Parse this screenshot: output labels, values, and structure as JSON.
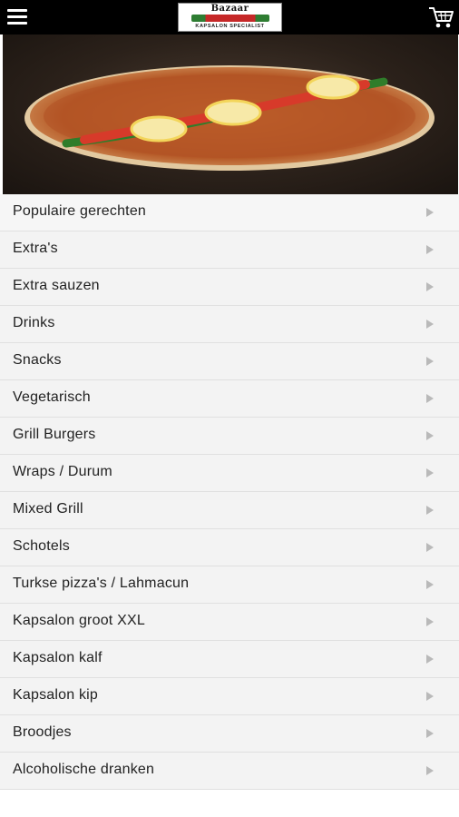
{
  "header": {
    "menu_icon": "hamburger-menu-icon",
    "logo": {
      "top_text": "Bazaar",
      "sub_text": "KAPSALON SPECIALIST"
    },
    "cart_icon": "shopping-cart-icon"
  },
  "hero": {
    "image": "turkish-pizza-lahmacun-photo"
  },
  "menu": {
    "items": [
      {
        "label": "Populaire gerechten"
      },
      {
        "label": "Extra's"
      },
      {
        "label": "Extra sauzen"
      },
      {
        "label": "Drinks"
      },
      {
        "label": "Snacks"
      },
      {
        "label": "Vegetarisch"
      },
      {
        "label": "Grill Burgers"
      },
      {
        "label": "Wraps / Durum"
      },
      {
        "label": "Mixed Grill"
      },
      {
        "label": "Schotels"
      },
      {
        "label": "Turkse pizza's / Lahmacun"
      },
      {
        "label": "Kapsalon groot XXL"
      },
      {
        "label": "Kapsalon kalf"
      },
      {
        "label": "Kapsalon kip"
      },
      {
        "label": "Broodjes"
      },
      {
        "label": "Alcoholische dranken"
      }
    ],
    "arrow_icon": "chevron-right-icon"
  },
  "colors": {
    "topbar": "#000000",
    "list_bg": "#f3f3f3",
    "divider": "#e0e0e0",
    "arrow": "#b9b9b9",
    "text": "#222222"
  }
}
